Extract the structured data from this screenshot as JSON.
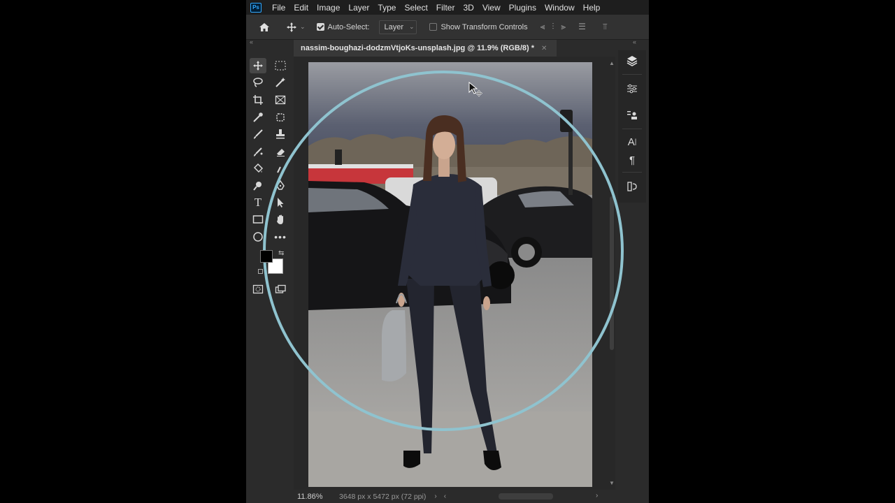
{
  "app": {
    "logo": "Ps"
  },
  "menu": [
    "File",
    "Edit",
    "Image",
    "Layer",
    "Type",
    "Select",
    "Filter",
    "3D",
    "View",
    "Plugins",
    "Window",
    "Help"
  ],
  "options": {
    "auto_select_label": "Auto-Select:",
    "auto_select_checked": true,
    "layer_select_value": "Layer",
    "show_transform_label": "Show Transform Controls",
    "show_transform_checked": false
  },
  "document": {
    "tab_title": "nassim-boughazi-dodzmVtjoKs-unsplash.jpg @ 11.9% (RGB/8) *"
  },
  "status": {
    "zoom": "11.86%",
    "doc_size": "3648 px x 5472 px (72 ppi)"
  },
  "colors": {
    "foreground": "#000000",
    "background": "#ffffff",
    "ring": "#8fc3cf"
  },
  "icons": {
    "toolbar": [
      "move-icon",
      "marquee-icon",
      "lasso-icon",
      "magic-wand-icon",
      "crop-icon",
      "frame-icon",
      "eyedropper-icon",
      "patch-icon",
      "brush-icon",
      "stamp-icon",
      "history-brush-icon",
      "eraser-icon",
      "paint-bucket-icon",
      "smudge-icon",
      "dodge-icon",
      "pen-icon",
      "type-icon",
      "path-select-icon",
      "rectangle-icon",
      "hand-icon",
      "ellipse-icon",
      "more-tools-icon"
    ],
    "panel": [
      "layers-icon",
      "adjustments-icon",
      "properties-icon",
      "character-icon",
      "paragraph-icon",
      "glyphs-icon"
    ]
  }
}
